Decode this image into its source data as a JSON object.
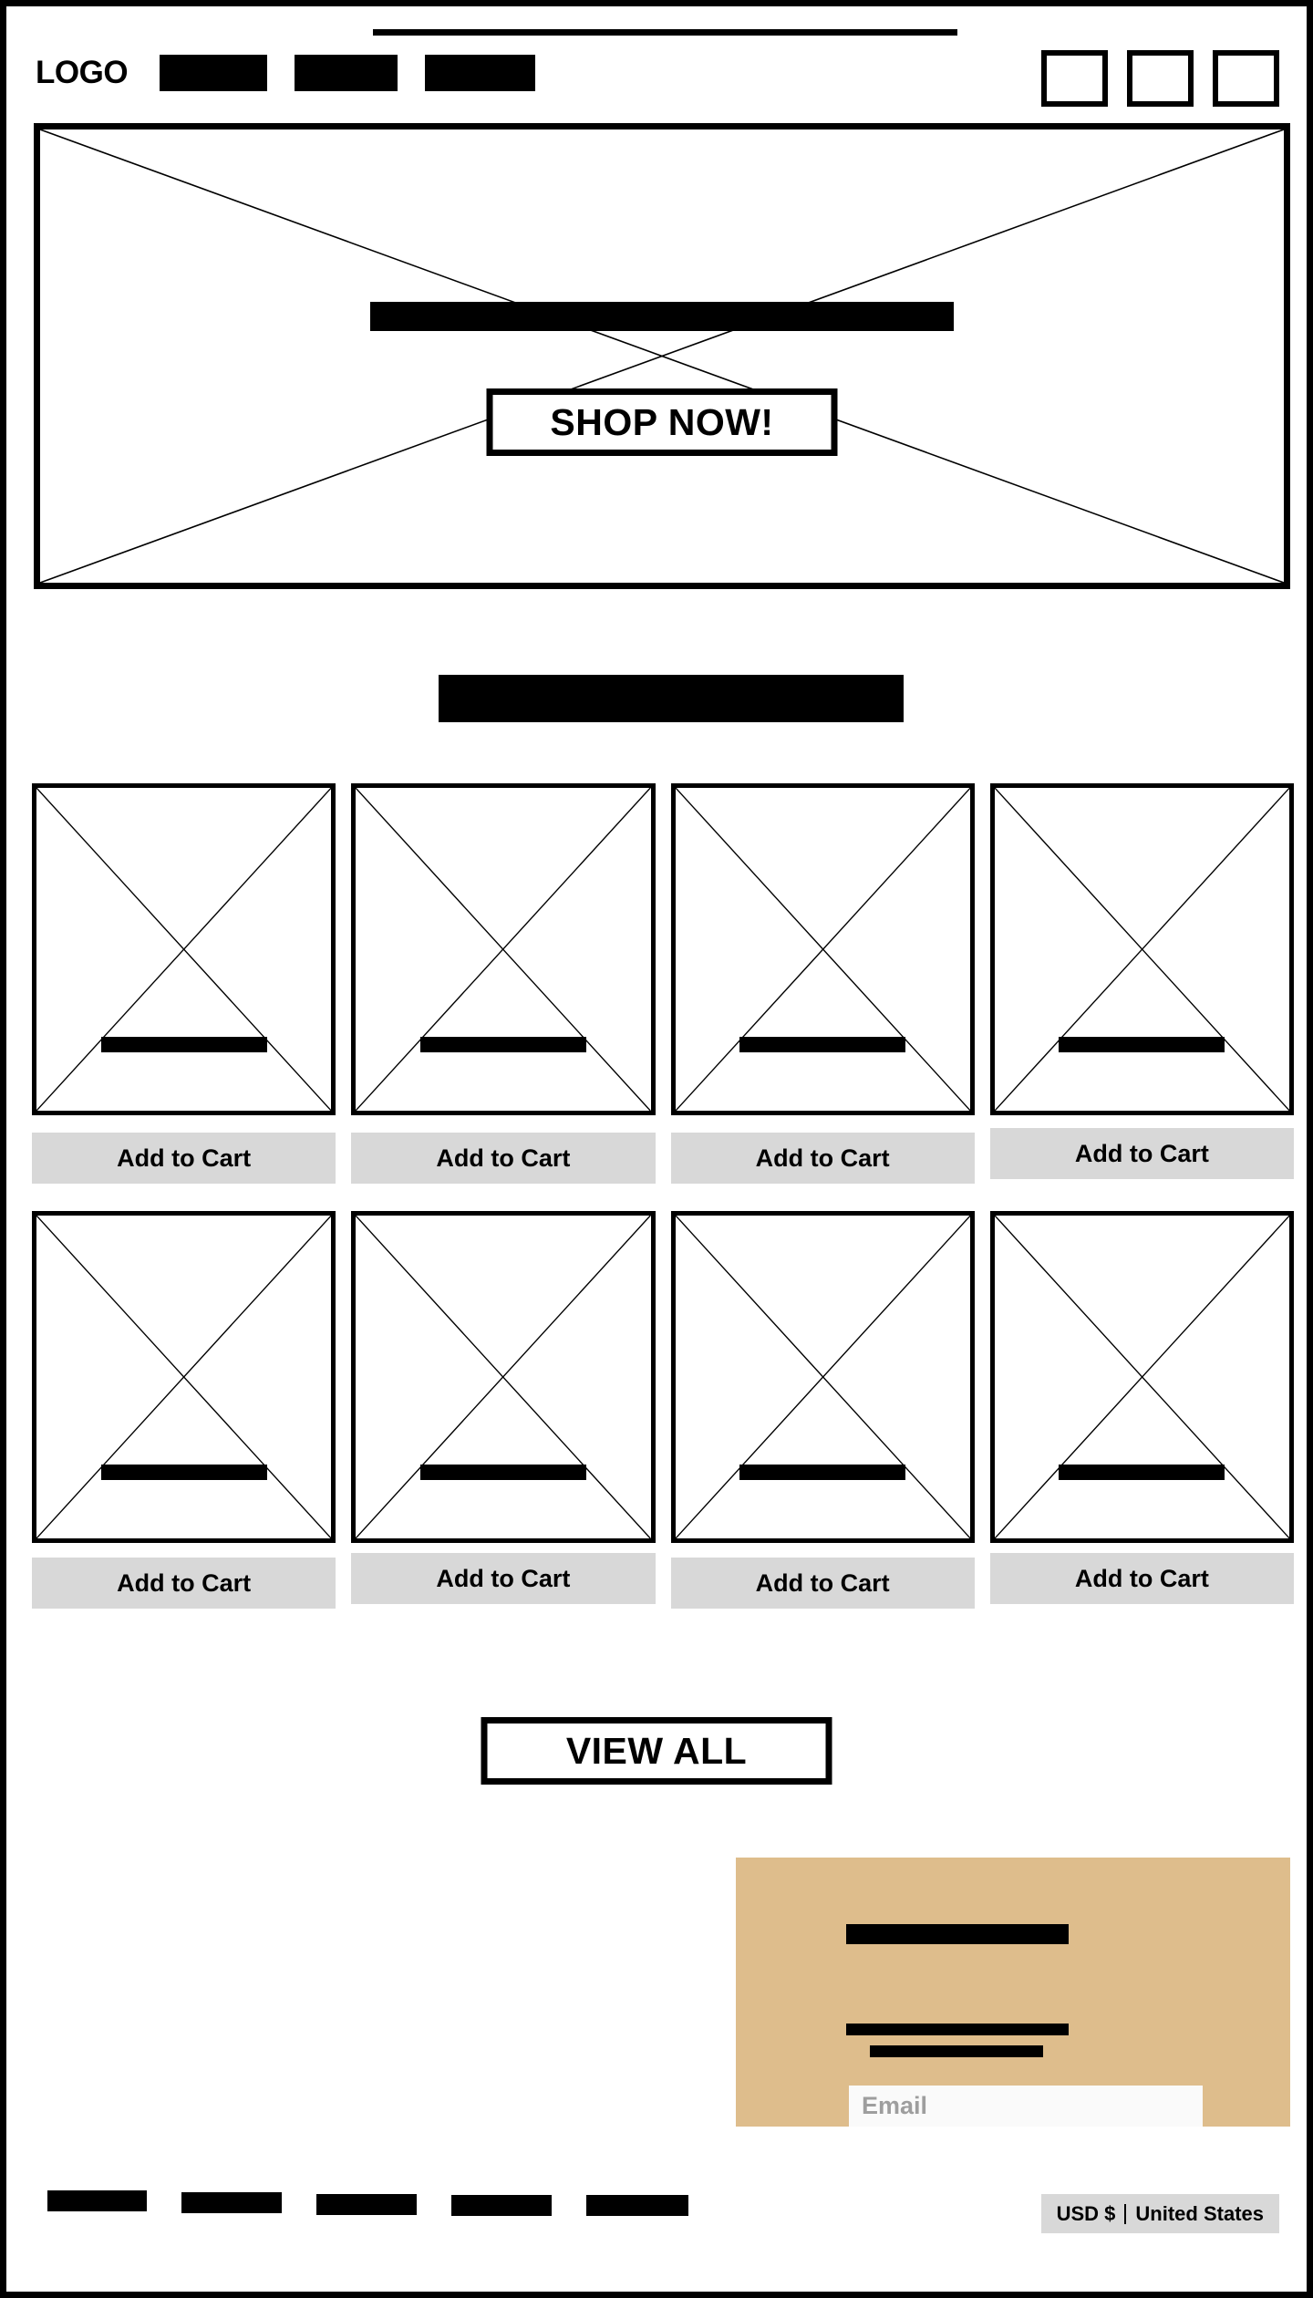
{
  "announcement": {
    "placeholder_bar": true
  },
  "header": {
    "logo": "LOGO",
    "nav_items": [
      {
        "name": "nav-link-1"
      },
      {
        "name": "nav-link-2"
      },
      {
        "name": "nav-link-3"
      }
    ],
    "icons": [
      {
        "name": "search-icon"
      },
      {
        "name": "account-icon"
      },
      {
        "name": "cart-icon"
      }
    ]
  },
  "hero": {
    "headline_bar": true,
    "cta_label": "SHOP NOW!"
  },
  "section": {
    "heading_bar": true
  },
  "products": {
    "add_to_cart_label": "Add to Cart",
    "rows": [
      [
        {
          "title_bar": true
        },
        {
          "title_bar": true
        },
        {
          "title_bar": true
        },
        {
          "title_bar": true
        }
      ],
      [
        {
          "title_bar": true
        },
        {
          "title_bar": true
        },
        {
          "title_bar": true
        },
        {
          "title_bar": true
        }
      ]
    ]
  },
  "view_all": {
    "label": "VIEW ALL"
  },
  "newsletter": {
    "background_color": "#debd8c",
    "heading_bar": true,
    "body_bars": 2,
    "email_placeholder": "Email"
  },
  "footer": {
    "links": [
      {
        "name": "footer-link-1"
      },
      {
        "name": "footer-link-2"
      },
      {
        "name": "footer-link-3"
      },
      {
        "name": "footer-link-4"
      },
      {
        "name": "footer-link-5"
      }
    ],
    "locale": {
      "currency": "USD $",
      "country": "United States"
    }
  },
  "colors": {
    "ink": "#000000",
    "paper": "#ffffff",
    "button_gray": "#d8d8d8",
    "newsletter_tan": "#debd8c",
    "input_white": "#fafafa",
    "placeholder_gray": "#9e9e9e"
  }
}
